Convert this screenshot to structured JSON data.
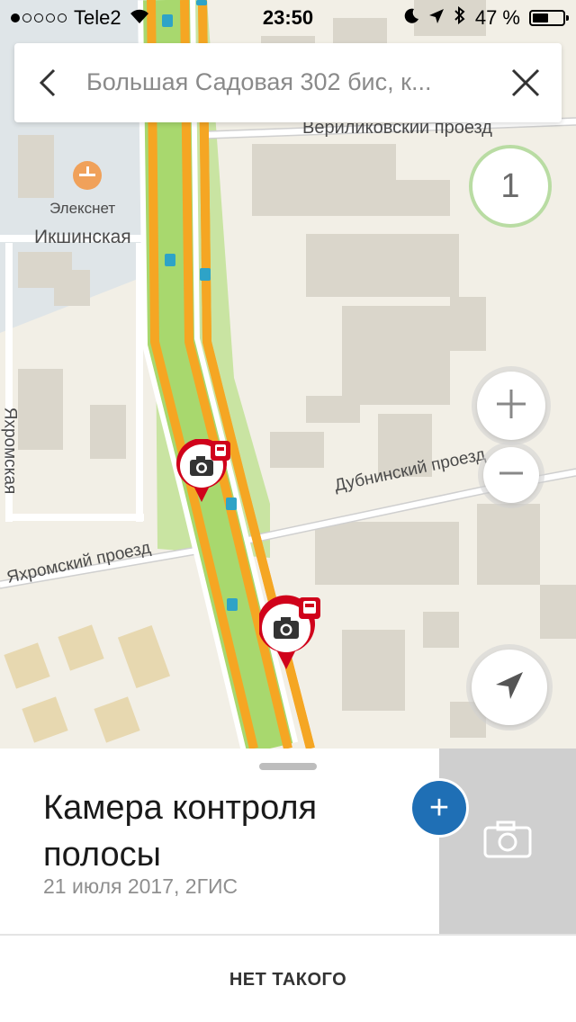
{
  "status_bar": {
    "carrier": "Tele2",
    "time": "23:50",
    "battery": "47 %",
    "battery_level": 0.47,
    "signal_icon": "signal-dots-icon",
    "wifi_icon": "wifi-icon",
    "moon_icon": "do-not-disturb-icon",
    "location_icon": "location-arrow-icon",
    "bluetooth_icon": "bluetooth-icon"
  },
  "search": {
    "query": "Большая Садовая 302 бис, к...",
    "back_icon": "back-chevron-icon",
    "close_icon": "close-icon"
  },
  "map": {
    "labels": {
      "street_top": "Вериликовский проезд",
      "elecknet": "Элекснет",
      "ikshinskaya": "Икшинская",
      "yakhromskaya": "Яхромская",
      "dubninsky": "Дубнинский проезд",
      "yakhromsky": "Яхромский проезд"
    },
    "layer_count": "1",
    "zoom_in": "+",
    "zoom_out": "−",
    "colors": {
      "road_orange": "#f5a623",
      "road_green": "#a8d86e",
      "marker_red": "#d0021b",
      "park": "#c9e4a2",
      "building": "#d9d6cc",
      "land": "#f2efe6"
    }
  },
  "card": {
    "title": "Камера контроля полосы",
    "subtitle": "21 июля 2017, 2ГИС",
    "add_label": "+",
    "add_color": "#1f6fb5",
    "photo_icon": "camera-icon"
  },
  "footer": {
    "button": "НЕТ ТАКОГО"
  }
}
